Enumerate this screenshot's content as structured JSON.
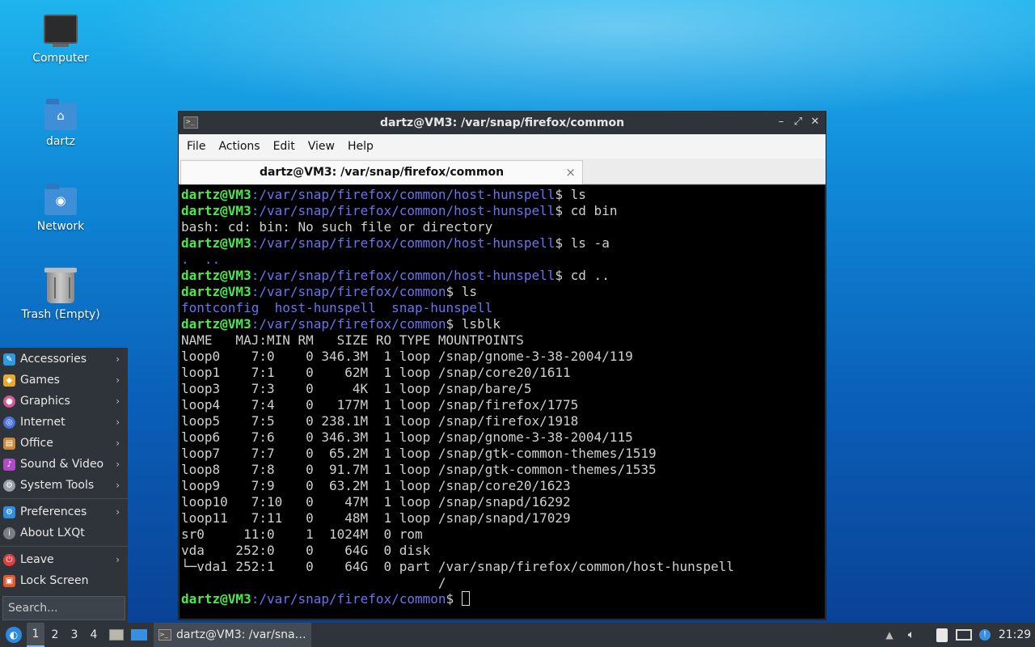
{
  "desktop": {
    "icons": [
      {
        "label": "Computer"
      },
      {
        "label": "dartz"
      },
      {
        "label": "Network"
      },
      {
        "label": "Trash (Empty)"
      }
    ]
  },
  "start_menu": {
    "items": [
      {
        "label": "Accessories",
        "icon": "accessories-icon",
        "color": "#2e9be0",
        "arrow": "›"
      },
      {
        "label": "Games",
        "icon": "games-icon",
        "color": "#e8a92c",
        "arrow": "›"
      },
      {
        "label": "Graphics",
        "icon": "graphics-icon",
        "color": "#d65a9b",
        "arrow": "›"
      },
      {
        "label": "Internet",
        "icon": "internet-icon",
        "color": "#4a72e0",
        "arrow": "›"
      },
      {
        "label": "Office",
        "icon": "office-icon",
        "color": "#c88a3a",
        "arrow": "›"
      },
      {
        "label": "Sound & Video",
        "icon": "sound-video-icon",
        "color": "#b04ac8",
        "arrow": "›"
      },
      {
        "label": "System Tools",
        "icon": "system-tools-icon",
        "color": "#9aa0a6",
        "arrow": "›"
      },
      {
        "label": "Preferences",
        "icon": "preferences-icon",
        "color": "#2e8fe0",
        "arrow": "›"
      },
      {
        "label": "About LXQt",
        "icon": "about-icon",
        "color": "#7a7f85",
        "arrow": ""
      },
      {
        "label": "Leave",
        "icon": "leave-icon",
        "color": "#e04040",
        "arrow": "›"
      },
      {
        "label": "Lock Screen",
        "icon": "lock-icon",
        "color": "#e05a30",
        "arrow": ""
      }
    ],
    "search_placeholder": "Search..."
  },
  "window": {
    "title": "dartz@VM3: /var/snap/firefox/common",
    "menus": [
      "File",
      "Actions",
      "Edit",
      "View",
      "Help"
    ],
    "tab_title": "dartz@VM3: /var/snap/firefox/common",
    "tab_close": "×",
    "controls": {
      "minimize": "–",
      "maximize": "⤢",
      "close": "✕"
    }
  },
  "terminal": {
    "lines": [
      {
        "user": "dartz@VM3",
        "path": ":/var/snap/firefox/common/host-hunspell",
        "text": "$ ls"
      },
      {
        "user": "dartz@VM3",
        "path": ":/var/snap/firefox/common/host-hunspell",
        "text": "$ cd bin"
      },
      {
        "user": "",
        "path": "",
        "text": "bash: cd: bin: No such file or directory"
      },
      {
        "user": "dartz@VM3",
        "path": ":/var/snap/firefox/common/host-hunspell",
        "text": "$ ls -a"
      },
      {
        "user": "",
        "path": ".  ..",
        "text": ""
      },
      {
        "user": "dartz@VM3",
        "path": ":/var/snap/firefox/common/host-hunspell",
        "text": "$ cd .."
      },
      {
        "user": "dartz@VM3",
        "path": ":/var/snap/firefox/common",
        "text": "$ ls"
      },
      {
        "user": "",
        "path": "fontconfig  host-hunspell  snap-hunspell",
        "text": ""
      },
      {
        "user": "dartz@VM3",
        "path": ":/var/snap/firefox/common",
        "text": "$ lsblk"
      },
      {
        "user": "",
        "path": "",
        "text": "NAME   MAJ:MIN RM   SIZE RO TYPE MOUNTPOINTS"
      },
      {
        "user": "",
        "path": "",
        "text": "loop0    7:0    0 346.3M  1 loop /snap/gnome-3-38-2004/119"
      },
      {
        "user": "",
        "path": "",
        "text": "loop1    7:1    0    62M  1 loop /snap/core20/1611"
      },
      {
        "user": "",
        "path": "",
        "text": "loop3    7:3    0     4K  1 loop /snap/bare/5"
      },
      {
        "user": "",
        "path": "",
        "text": "loop4    7:4    0   177M  1 loop /snap/firefox/1775"
      },
      {
        "user": "",
        "path": "",
        "text": "loop5    7:5    0 238.1M  1 loop /snap/firefox/1918"
      },
      {
        "user": "",
        "path": "",
        "text": "loop6    7:6    0 346.3M  1 loop /snap/gnome-3-38-2004/115"
      },
      {
        "user": "",
        "path": "",
        "text": "loop7    7:7    0  65.2M  1 loop /snap/gtk-common-themes/1519"
      },
      {
        "user": "",
        "path": "",
        "text": "loop8    7:8    0  91.7M  1 loop /snap/gtk-common-themes/1535"
      },
      {
        "user": "",
        "path": "",
        "text": "loop9    7:9    0  63.2M  1 loop /snap/core20/1623"
      },
      {
        "user": "",
        "path": "",
        "text": "loop10   7:10   0    47M  1 loop /snap/snapd/16292"
      },
      {
        "user": "",
        "path": "",
        "text": "loop11   7:11   0    48M  1 loop /snap/snapd/17029"
      },
      {
        "user": "",
        "path": "",
        "text": "sr0     11:0    1  1024M  0 rom"
      },
      {
        "user": "",
        "path": "",
        "text": "vda    252:0    0    64G  0 disk"
      },
      {
        "user": "",
        "path": "",
        "text": "└─vda1 252:1    0    64G  0 part /var/snap/firefox/common/host-hunspell"
      },
      {
        "user": "",
        "path": "",
        "text": "                                 /"
      },
      {
        "user": "dartz@VM3",
        "path": ":/var/snap/firefox/common",
        "text": "$ ",
        "cursor": true
      }
    ]
  },
  "taskbar": {
    "desktops": [
      "1",
      "2",
      "3",
      "4"
    ],
    "task_label": "dartz@VM3: /var/sna…",
    "clock": "21:29"
  }
}
